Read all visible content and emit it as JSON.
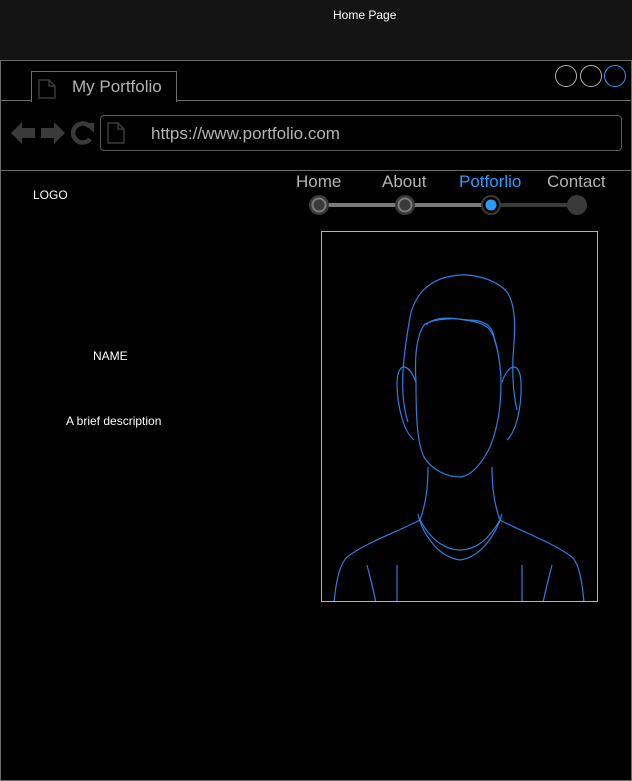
{
  "page_title": "Home Page",
  "browser": {
    "tab_title": "My Portfolio",
    "url": "https://www.portfolio.com"
  },
  "site": {
    "logo": "LOGO",
    "nav": [
      {
        "label": "Home"
      },
      {
        "label": "About"
      },
      {
        "label": "Potforlio",
        "active": true
      },
      {
        "label": "Contact"
      }
    ],
    "name": "NAME",
    "description": "A brief description"
  },
  "colors": {
    "accent": "#2b9bff",
    "background": "#000000",
    "text_muted": "#b3b3b3"
  },
  "icons": [
    "document-icon",
    "back-arrow-icon",
    "forward-arrow-icon",
    "reload-icon",
    "person-silhouette-icon"
  ]
}
